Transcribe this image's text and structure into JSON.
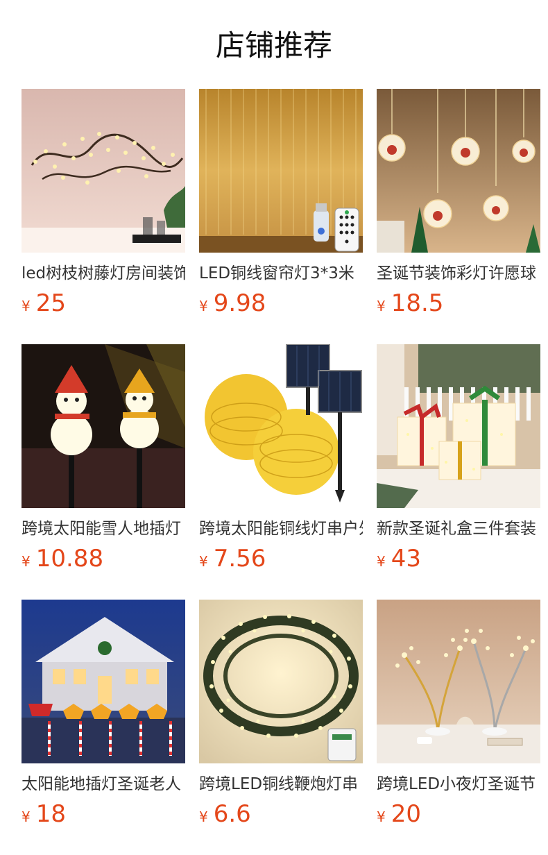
{
  "page": {
    "title": "店铺推荐"
  },
  "products": [
    {
      "name": "led树枝树藤灯房间装饰",
      "currency": "¥",
      "price": "25",
      "image": "vine-branch-lights"
    },
    {
      "name": "LED铜线窗帘灯3*3米",
      "currency": "¥",
      "price": "9.98",
      "image": "curtain-lights"
    },
    {
      "name": "圣诞节装饰彩灯许愿球",
      "currency": "¥",
      "price": "18.5",
      "image": "wishing-ball-lights"
    },
    {
      "name": "跨境太阳能雪人地插灯",
      "currency": "¥",
      "price": "10.88",
      "image": "solar-snowman-lights"
    },
    {
      "name": "跨境太阳能铜线灯串户外",
      "currency": "¥",
      "price": "7.56",
      "image": "solar-copper-string"
    },
    {
      "name": "新款圣诞礼盒三件套装",
      "currency": "¥",
      "price": "43",
      "image": "christmas-gift-boxes"
    },
    {
      "name": "太阳能地插灯圣诞老人",
      "currency": "¥",
      "price": "18",
      "image": "solar-stake-lights"
    },
    {
      "name": "跨境LED铜线鞭炮灯串",
      "currency": "¥",
      "price": "6.6",
      "image": "firecracker-lights"
    },
    {
      "name": "跨境LED小夜灯圣诞节",
      "currency": "¥",
      "price": "20",
      "image": "tree-night-light"
    }
  ]
}
